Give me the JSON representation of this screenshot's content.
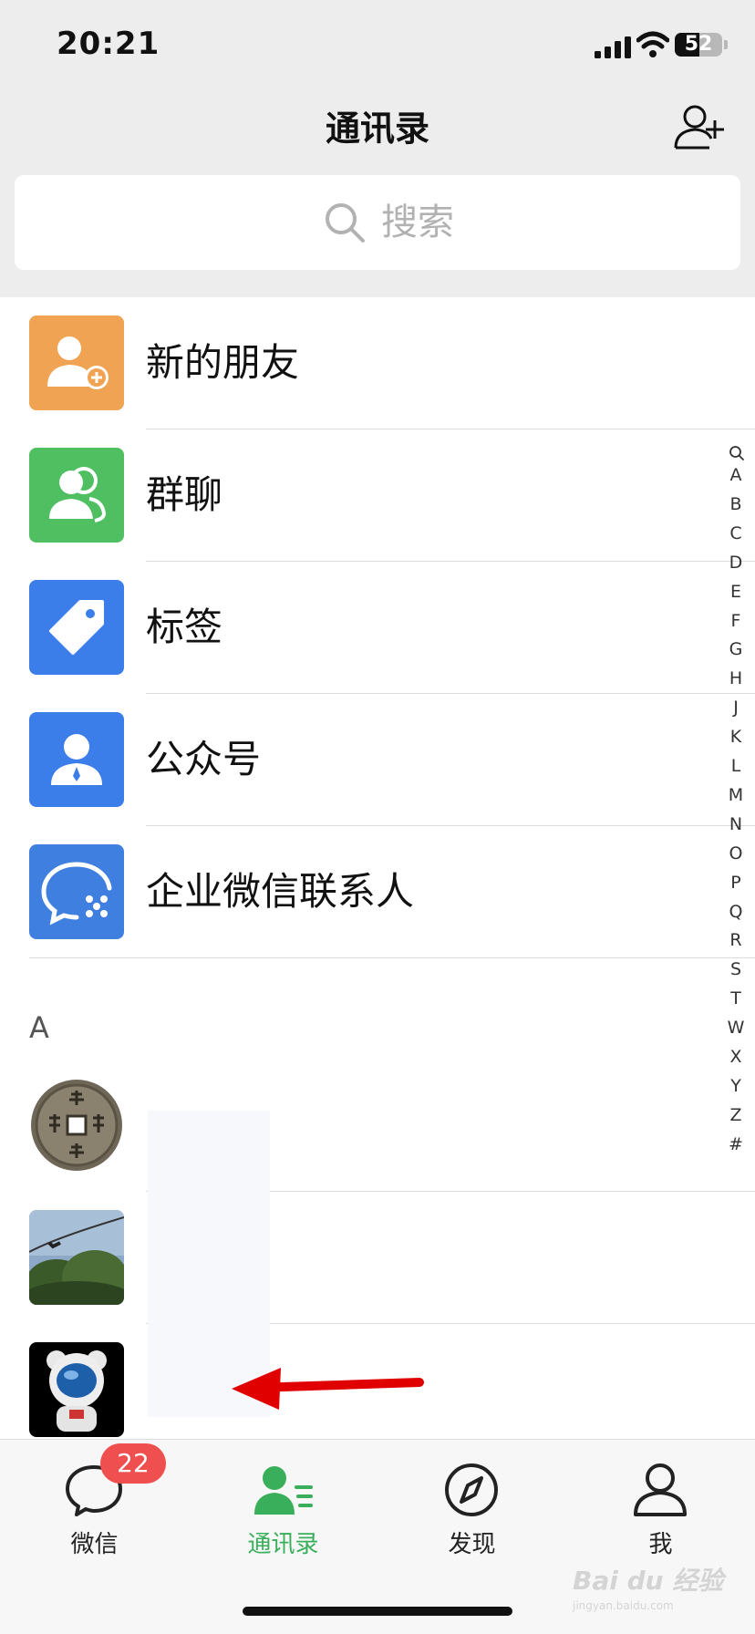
{
  "status_bar": {
    "time": "20:21",
    "battery_level": "52",
    "battery_fraction": 0.52
  },
  "header": {
    "title": "通讯录",
    "icons": {
      "add": "add-friend-icon"
    }
  },
  "search": {
    "placeholder": "搜索",
    "icon": "search-icon"
  },
  "features": [
    {
      "label": "新的朋友",
      "icon": "new-friend-icon",
      "color": "#f0a352"
    },
    {
      "label": "群聊",
      "icon": "group-chat-icon",
      "color": "#4fbf62"
    },
    {
      "label": "标签",
      "icon": "tag-icon",
      "color": "#3b7de9"
    },
    {
      "label": "公众号",
      "icon": "official-account-icon",
      "color": "#3b7de9"
    },
    {
      "label": "企业微信联系人",
      "icon": "wecom-icon",
      "color": "#3f7fe0"
    }
  ],
  "section": {
    "letter": "A"
  },
  "contacts": [
    {
      "name": "",
      "avatar": "coin-avatar"
    },
    {
      "name": "",
      "avatar": "sky-tree-avatar"
    },
    {
      "name": "",
      "avatar": "astronaut-bear-avatar"
    }
  ],
  "index_bar": [
    "A",
    "B",
    "C",
    "D",
    "E",
    "F",
    "G",
    "H",
    "J",
    "K",
    "L",
    "M",
    "N",
    "O",
    "P",
    "Q",
    "R",
    "S",
    "T",
    "W",
    "X",
    "Y",
    "Z",
    "#"
  ],
  "tabs": [
    {
      "label": "微信",
      "icon": "chat-bubble-icon",
      "badge": "22",
      "active": false
    },
    {
      "label": "通讯录",
      "icon": "contacts-icon",
      "active": true
    },
    {
      "label": "发现",
      "icon": "compass-icon",
      "active": false
    },
    {
      "label": "我",
      "icon": "person-icon",
      "active": false
    }
  ],
  "watermark": {
    "brand": "Bai du 经验",
    "url": "jingyan.baidu.com"
  },
  "colors": {
    "accent": "#3aaf5b",
    "badge": "#ef4f4f",
    "arrow": "#e00000"
  }
}
